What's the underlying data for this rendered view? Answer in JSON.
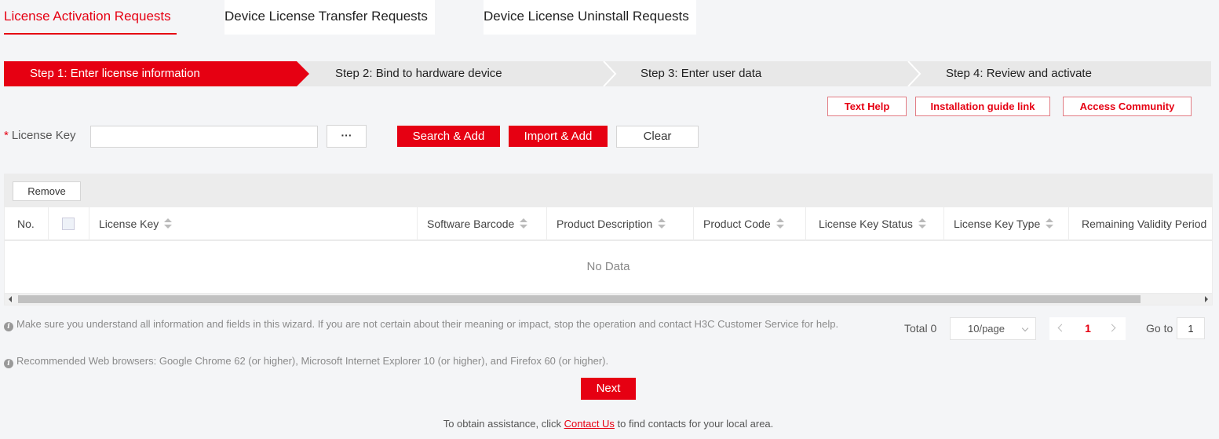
{
  "tabs": [
    {
      "label": "License Activation Requests",
      "active": true
    },
    {
      "label": "Device License Transfer Requests",
      "active": false
    },
    {
      "label": "Device License Uninstall Requests",
      "active": false
    }
  ],
  "steps": [
    {
      "label": "Step 1: Enter license information",
      "active": true
    },
    {
      "label": "Step 2: Bind to hardware device",
      "active": false
    },
    {
      "label": "Step 3: Enter user data",
      "active": false
    },
    {
      "label": "Step 4: Review and activate",
      "active": false
    }
  ],
  "help_links": {
    "text_help": "Text Help",
    "installation_guide": "Installation guide link",
    "access_community": "Access Community"
  },
  "license_form": {
    "required_mark": "*",
    "label": "License Key",
    "value": "",
    "placeholder": "",
    "browse_label": "···",
    "search_add": "Search & Add",
    "import_add": "Import & Add",
    "clear": "Clear"
  },
  "table": {
    "remove_label": "Remove",
    "columns": [
      "No.",
      "",
      "License Key",
      "Software Barcode",
      "Product Description",
      "Product Code",
      "License Key Status",
      "License Key Type",
      "Remaining Validity Period"
    ],
    "rows": [],
    "empty_text": "No Data"
  },
  "notes": {
    "note1": "Make sure you understand all information and fields in this wizard. If you are not certain about their meaning or impact, stop the operation and contact H3C Customer Service for help.",
    "note2": "Recommended Web browsers: Google Chrome 62 (or higher), Microsoft Internet Explorer 10 (or higher), and Firefox 60 (or higher)."
  },
  "pagination": {
    "total_label": "Total 0",
    "page_size": "10/page",
    "current_page": "1",
    "goto_label": "Go to",
    "goto_value": "1"
  },
  "next_label": "Next",
  "footer": {
    "prefix": "To obtain assistance, click ",
    "link": "Contact Us",
    "suffix": " to find contacts for your local area."
  },
  "colors": {
    "accent": "#e60012",
    "background": "#f4f5f7",
    "step_inactive": "#e8e8e8"
  }
}
